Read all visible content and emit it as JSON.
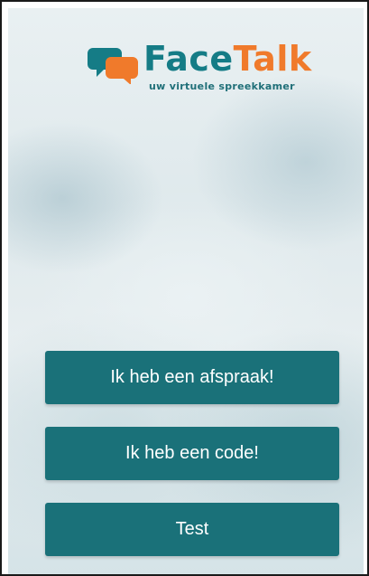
{
  "logo": {
    "brand_part1": "Face",
    "brand_part2": "Talk",
    "tagline": "uw virtuele spreekkamer",
    "icon": "speech-bubbles-icon",
    "colors": {
      "primary": "#157c86",
      "accent": "#f07a2b"
    }
  },
  "actions": {
    "appointment_label": "Ik heb een afspraak!",
    "code_label": "Ik heb een code!",
    "test_label": "Test"
  },
  "theme": {
    "button_color": "#1a7179",
    "button_text_color": "#ffffff"
  }
}
